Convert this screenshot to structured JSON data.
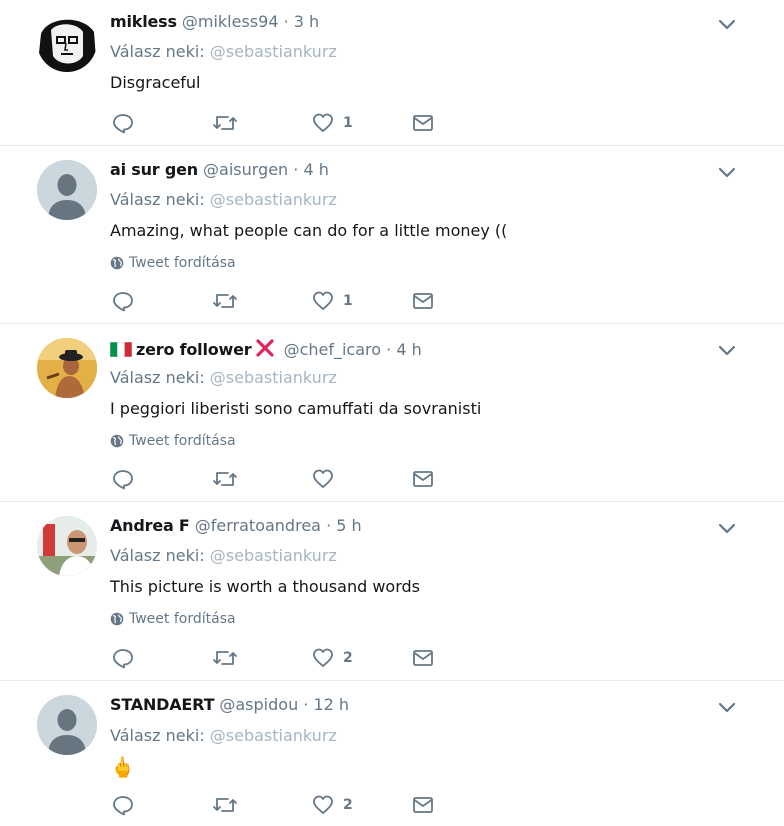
{
  "reply_prefix": "Válasz neki:",
  "translate_label": "Tweet fordítása",
  "colors": {
    "accent": "#1da1f2",
    "muted": "#657786",
    "mention_faded": "#a6b5c1",
    "flag_green": "#009246",
    "flag_red": "#ce2b37",
    "x_red": "#e0245e"
  },
  "tweets": [
    {
      "name": "mikless",
      "handle": "@mikless94",
      "dot": "·",
      "time": "3 h",
      "reply_to": "@sebastiankurz",
      "text": "Disgraceful",
      "show_translate": false,
      "likes": "1",
      "avatar": "sketch-portrait"
    },
    {
      "name": "ai sur gen",
      "handle": "@aisurgen",
      "dot": "·",
      "time": "4 h",
      "reply_to": "@sebastiankurz",
      "text": "Amazing, what people can do for a little money ((",
      "show_translate": true,
      "likes": "1",
      "avatar": "default-egg"
    },
    {
      "name": "zero follower",
      "handle": "@chef_icaro",
      "dot": "·",
      "time": "4 h",
      "reply_to": "@sebastiankurz",
      "text": "I peggiori liberisti sono camuffati da sovranisti",
      "show_translate": true,
      "likes": "",
      "avatar": "photo-hat-man",
      "name_prefix_icon": "italy-flag-emoji",
      "name_suffix_icon": "red-x-emoji"
    },
    {
      "name": "Andrea F",
      "handle": "@ferratoandrea",
      "dot": "·",
      "time": "5 h",
      "reply_to": "@sebastiankurz",
      "text": "This picture is worth a thousand words",
      "show_translate": true,
      "likes": "2",
      "avatar": "photo-selfie"
    },
    {
      "name": "STANDAERT",
      "handle": "@aspidou",
      "dot": "·",
      "time": "12 h",
      "reply_to": "@sebastiankurz",
      "text": "🖕",
      "show_translate": false,
      "likes": "2",
      "avatar": "default-egg"
    }
  ]
}
